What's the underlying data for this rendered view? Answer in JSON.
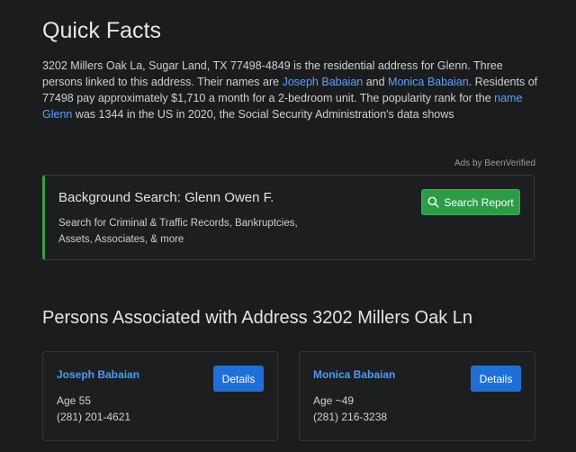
{
  "quick_facts": {
    "title": "Quick Facts",
    "text_1": "3202 Millers Oak La, Sugar Land, TX 77498-4849 is the residential address for Glenn. Three persons linked to this address. Their names are ",
    "link_person_1": "Joseph Babaian",
    "text_2": " and ",
    "link_person_2": "Monica Babaian",
    "text_3": ". Residents of 77498 pay approximately $1,710 a month for a 2-bedroom unit. The popularity rank for the ",
    "link_name": "name Glenn",
    "text_4": " was 1344 in the US in 2020, the Social Security Administration's data shows"
  },
  "ads_note": "Ads by BeenVerified",
  "background_search": {
    "title": "Background Search: Glenn Owen F.",
    "description": "Search for Criminal & Traffic Records, Bankruptcies, Assets, Associates, & more",
    "button_label": "Search Report",
    "button_icon": "search-icon",
    "accent_color": "#3e9a4a"
  },
  "persons_section": {
    "title": "Persons Associated with Address 3202 Millers Oak Ln",
    "persons": [
      {
        "name": "Joseph Babaian",
        "age": "Age 55",
        "phone": "(281) 201-4621",
        "button_label": "Details"
      },
      {
        "name": "Monica Babaian",
        "age": "Age ~49",
        "phone": "(281) 216-3238",
        "button_label": "Details"
      }
    ]
  }
}
